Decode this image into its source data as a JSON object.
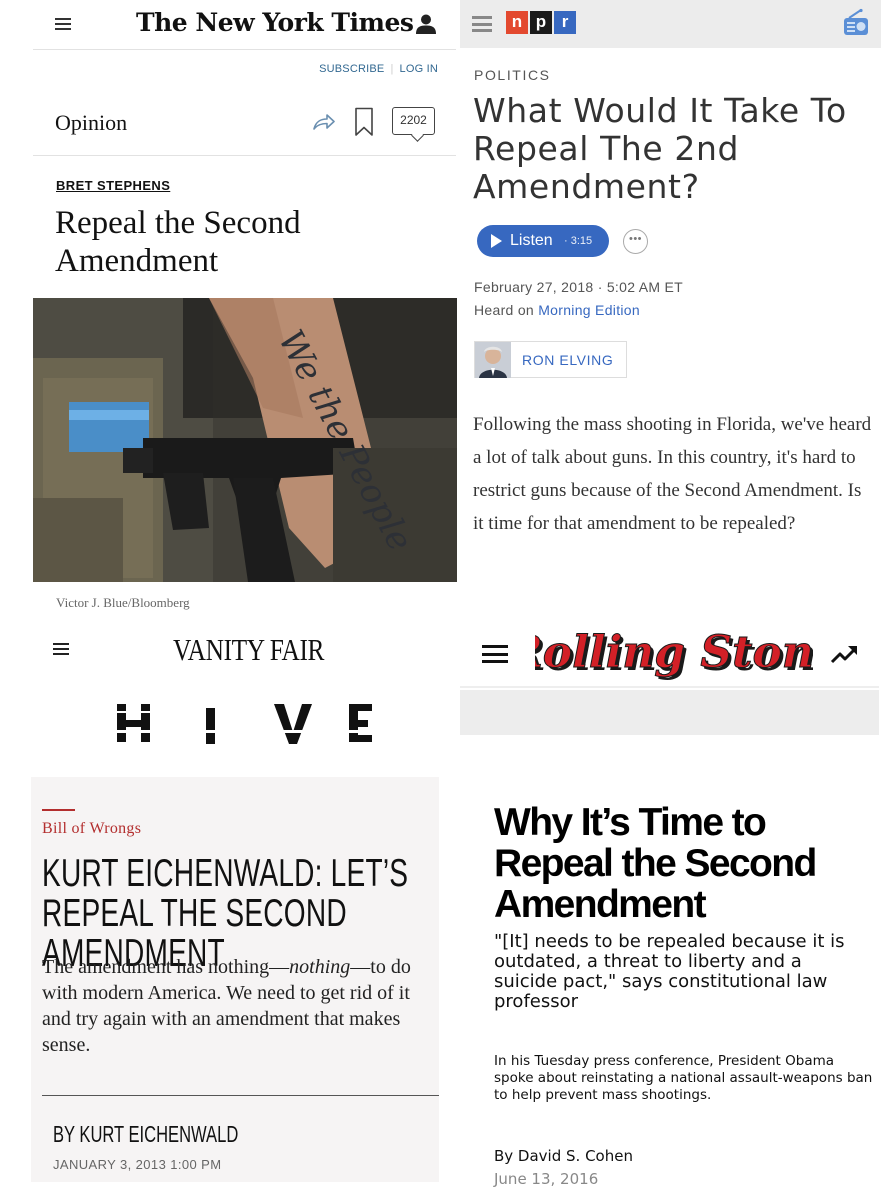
{
  "nyt": {
    "logo": "The New York Times",
    "subscribe": "SUBSCRIBE",
    "login": "LOG IN",
    "section": "Opinion",
    "comment_count": "2202",
    "author": "BRET STEPHENS",
    "headline": "Repeal the Second Amendment",
    "photo_credit": "Victor J. Blue/Bloomberg",
    "photo_tattoo": "We the People",
    "icons": [
      "menu-icon",
      "user-icon",
      "share-icon",
      "bookmark-icon",
      "comment-icon"
    ]
  },
  "npr": {
    "logo_letters": [
      "n",
      "p",
      "r"
    ],
    "colors": {
      "n": "#e3492f",
      "p": "#1a1a1a",
      "r": "#3768c0"
    },
    "kicker": "POLITICS",
    "headline": "What Would It Take To Repeal The 2nd Amendment?",
    "listen_label": "Listen",
    "listen_duration": "· 3:15",
    "more_label": "•••",
    "date": "February 27, 2018 · 5:02 AM ET",
    "heard_prefix": "Heard on ",
    "heard_show": "Morning Edition",
    "author": "RON ELVING",
    "body": "Following the mass shooting in Florida, we've heard a lot of talk about guns. In this country, it's hard to restrict guns because of the Second Amendment. Is it time for that amendment to be repealed?"
  },
  "vf": {
    "logo": "VANITY FAIR",
    "hive_logo": "HIVE",
    "kicker": "Bill of Wrongs",
    "headline": "KURT EICHENWALD: LET’S REPEAL THE SECOND AMENDMENT",
    "dek_1": "The amendment has nothing—",
    "dek_em": "nothing",
    "dek_2": "—to do with modern America. We need to get rid of it and try again with an amendment that makes sense.",
    "byline": "BY KURT EICHENWALD",
    "date": "JANUARY 3, 2013 1:00 PM",
    "accent": "#b32e2e"
  },
  "rs": {
    "logo": "Rolling Stone",
    "headline": "Why It’s Time to Repeal the Second Amendment",
    "dek": "\"[It] needs to be repealed because it is outdated, a threat to liberty and a suicide pact,\" says constitutional law professor",
    "body": "In his Tuesday press conference, President Obama spoke about reinstating a national assault-weapons ban to help prevent mass shootings.",
    "byline": "By David S. Cohen",
    "date": "June 13, 2016",
    "accent": "#d32027"
  }
}
